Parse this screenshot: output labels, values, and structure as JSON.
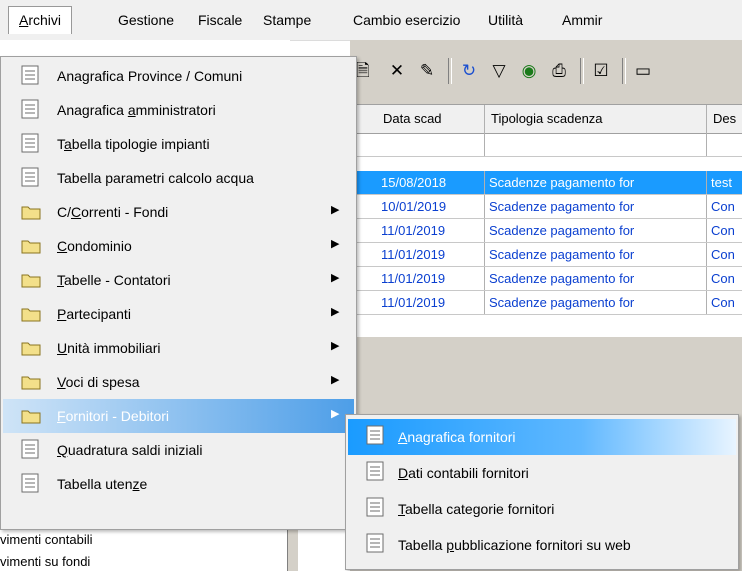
{
  "menubar": {
    "items": [
      {
        "label": "Archivi",
        "underline": "A"
      },
      {
        "label": "Gestione"
      },
      {
        "label": "Fiscale"
      },
      {
        "label": "Stampe"
      },
      {
        "label": "Cambio esercizio"
      },
      {
        "label": "Utilità"
      },
      {
        "label": "Ammir"
      }
    ]
  },
  "background": {
    "tree": [
      "vimenti contabili",
      "vimenti su fondi"
    ]
  },
  "toolbar": {
    "icons": [
      "edit-icon",
      "delete-icon",
      "edit-note-icon",
      "refresh-icon",
      "filter-icon",
      "globe-icon",
      "print-icon",
      "checklist-icon",
      "window-icon"
    ]
  },
  "grid": {
    "headers": [
      "Data scad",
      "Tipologia scadenza",
      "Des"
    ],
    "rows": [
      {
        "date": "15/08/2018",
        "type": "Scadenze pagamento for",
        "desc": "test",
        "selected": true
      },
      {
        "date": "10/01/2019",
        "type": "Scadenze pagamento for",
        "desc": "Con"
      },
      {
        "date": "11/01/2019",
        "type": "Scadenze pagamento for",
        "desc": "Con"
      },
      {
        "date": "11/01/2019",
        "type": "Scadenze pagamento for",
        "desc": "Con"
      },
      {
        "date": "11/01/2019",
        "type": "Scadenze pagamento for",
        "desc": "Con"
      },
      {
        "date": "11/01/2019",
        "type": "Scadenze pagamento for",
        "desc": "Con"
      }
    ]
  },
  "menu": {
    "items": [
      {
        "pre": "Anagrafica Province / Comuni",
        "u": "",
        "post": "",
        "icon": "doc"
      },
      {
        "pre": "Anagrafica ",
        "u": "a",
        "post": "mministratori",
        "icon": "doc"
      },
      {
        "pre": "T",
        "u": "a",
        "post": "bella tipologie impianti",
        "icon": "doc"
      },
      {
        "pre": "Tabella parametri calcolo acqua",
        "u": "",
        "post": "",
        "icon": "doc"
      },
      {
        "pre": "C/",
        "u": "C",
        "post": "orrenti - Fondi",
        "icon": "folder",
        "sub": true
      },
      {
        "pre": "",
        "u": "C",
        "post": "ondominio",
        "icon": "folder",
        "sub": true
      },
      {
        "pre": "",
        "u": "T",
        "post": "abelle - Contatori",
        "icon": "folder",
        "sub": true
      },
      {
        "pre": "",
        "u": "P",
        "post": "artecipanti",
        "icon": "folder",
        "sub": true
      },
      {
        "pre": "",
        "u": "U",
        "post": "nità immobiliari",
        "icon": "folder",
        "sub": true
      },
      {
        "pre": "",
        "u": "V",
        "post": "oci di spesa",
        "icon": "folder",
        "sub": true
      },
      {
        "pre": "",
        "u": "F",
        "post": "ornitori - Debitori",
        "icon": "folder",
        "sub": true,
        "highlight": true
      },
      {
        "pre": "",
        "u": "Q",
        "post": "uadratura saldi iniziali",
        "icon": "doc"
      },
      {
        "pre": "Tabella uten",
        "u": "z",
        "post": "e",
        "icon": "doc"
      }
    ]
  },
  "submenu": {
    "items": [
      {
        "pre": "",
        "u": "A",
        "post": "nagrafica fornitori",
        "highlight": true
      },
      {
        "pre": "",
        "u": "D",
        "post": "ati contabili fornitori"
      },
      {
        "pre": "",
        "u": "T",
        "post": "abella categorie fornitori"
      },
      {
        "pre": "Tabella ",
        "u": "p",
        "post": "ubblicazione fornitori su web"
      }
    ]
  }
}
